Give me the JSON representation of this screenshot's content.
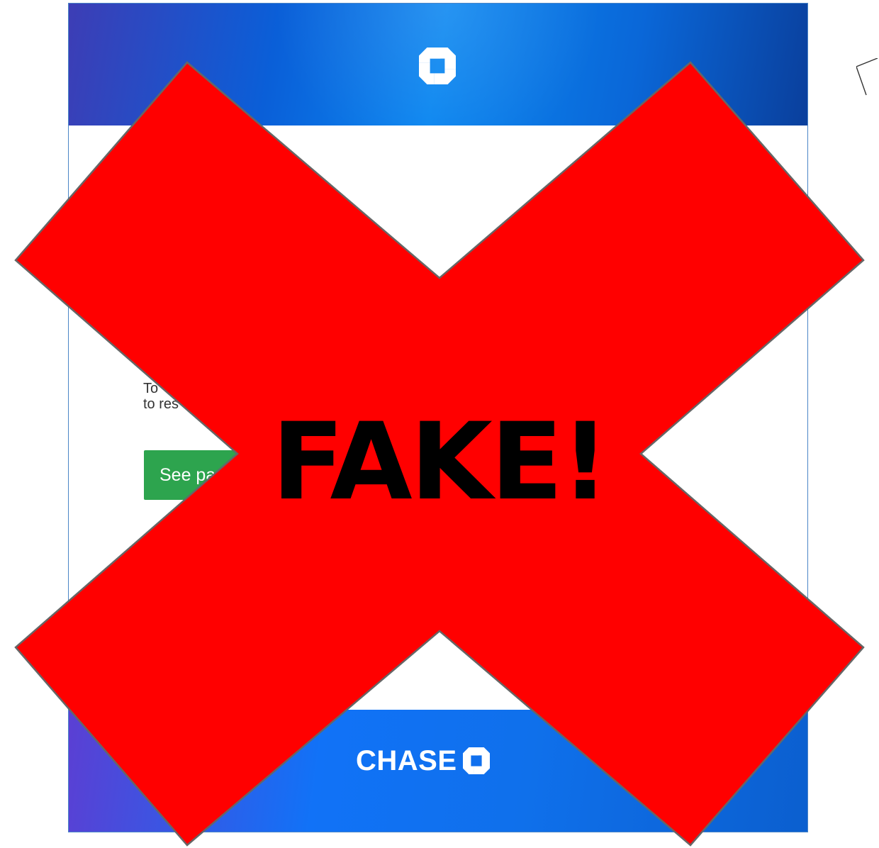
{
  "email": {
    "body_text": {
      "line_1": "To",
      "line_2": "to res"
    },
    "button": {
      "label": "See pa",
      "background": "#2da44e"
    },
    "footer": {
      "brand": "CHASE"
    },
    "colors": {
      "header_blue": "#0a86f0",
      "footer_blue": "#1172f7",
      "border": "#4b86c7"
    },
    "icons": {
      "header": "chase-octagon-icon",
      "footer": "chase-octagon-icon",
      "corner": "pointer-outline-icon"
    }
  },
  "warning_overlay": {
    "label": "FAKE!",
    "mark_color": "#ff0000",
    "outline_color": "#666666",
    "icon": "red-x-mark-icon"
  }
}
